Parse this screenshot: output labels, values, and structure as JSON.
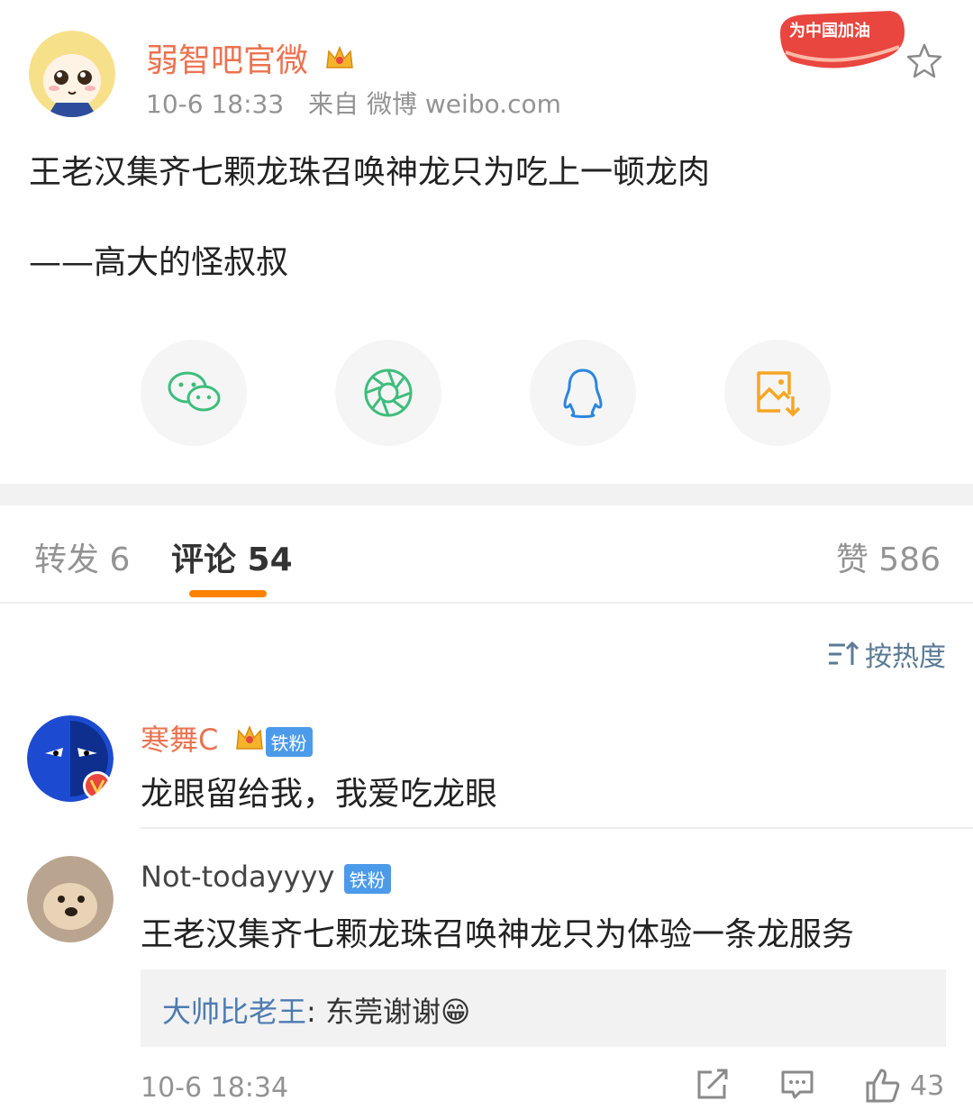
{
  "post": {
    "author": "弱智吧官微",
    "time": "10-6 18:33",
    "source": "来自 微博 weibo.com",
    "badge_text": "为中国加油",
    "line1": "王老汉集齐七颗龙珠召唤神龙只为吃上一顿龙肉",
    "line2": "——高大的怪叔叔"
  },
  "share": {
    "items": [
      {
        "icon": "wechat-icon"
      },
      {
        "icon": "moments-icon"
      },
      {
        "icon": "qq-icon"
      },
      {
        "icon": "save-image-icon"
      }
    ]
  },
  "tabs": {
    "repost": "转发 6",
    "comment": "评论 54",
    "like": "赞 586"
  },
  "sort": {
    "label": "按热度"
  },
  "comments": [
    {
      "name": "寒舞C",
      "fan_badge": "铁粉",
      "text": "龙眼留给我，我爱吃龙眼"
    },
    {
      "name": "Not-todayyyy",
      "fan_badge": "铁粉",
      "text": "王老汉集齐七颗龙珠召唤神龙只为体验一条龙服务",
      "reply_user": "大帅比老王",
      "reply_sep": ": ",
      "reply_text": "东莞谢谢😁",
      "time": "10-6 18:34",
      "likes": "43"
    }
  ],
  "colors": {
    "accent": "#ff8200",
    "author": "#eb7350",
    "link": "#4d7bb1",
    "muted": "#939393"
  }
}
